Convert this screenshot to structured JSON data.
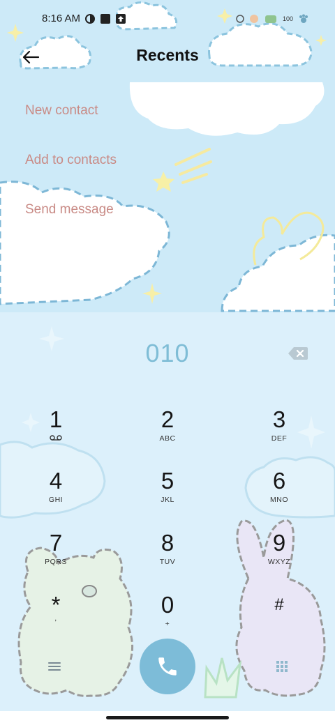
{
  "status_bar": {
    "time": "8:16 AM",
    "battery": "100",
    "icons": [
      "data-saver-icon",
      "square-app-icon",
      "upload-icon",
      "cloud-sticker-icon"
    ]
  },
  "header": {
    "title": "Recents",
    "back_icon": "arrow-left-icon"
  },
  "menu": {
    "items": [
      {
        "label": "New contact"
      },
      {
        "label": "Add to contacts"
      },
      {
        "label": "Send message"
      }
    ]
  },
  "dialer": {
    "number": "010",
    "backspace_icon": "backspace-icon"
  },
  "keypad": [
    {
      "digit": "1",
      "letters": ""
    },
    {
      "digit": "2",
      "letters": "ABC"
    },
    {
      "digit": "3",
      "letters": "DEF"
    },
    {
      "digit": "4",
      "letters": "GHI"
    },
    {
      "digit": "5",
      "letters": "JKL"
    },
    {
      "digit": "6",
      "letters": "MNO"
    },
    {
      "digit": "7",
      "letters": "PQRS"
    },
    {
      "digit": "8",
      "letters": "TUV"
    },
    {
      "digit": "9",
      "letters": "WXYZ"
    },
    {
      "digit": "*",
      "letters": ","
    },
    {
      "digit": "0",
      "letters": "+"
    },
    {
      "digit": "#",
      "letters": ""
    }
  ],
  "controls": {
    "menu_icon": "hamburger-menu-icon",
    "call_icon": "phone-icon",
    "dialpad_icon": "dialpad-grid-icon"
  },
  "colors": {
    "accent": "#7dbcd8",
    "menu_text": "#c98b86",
    "number": "#7fbdd6"
  }
}
